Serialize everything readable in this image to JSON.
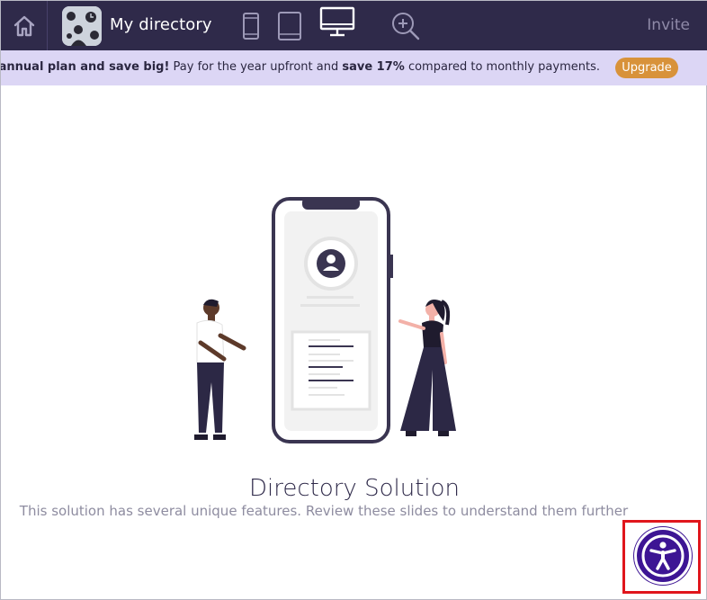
{
  "header": {
    "app_title": "My directory",
    "invite_label": "Invite",
    "icons": {
      "home": "home-icon",
      "mobile": "mobile-device-icon",
      "tablet": "tablet-device-icon",
      "desktop": "desktop-device-icon",
      "zoom": "zoom-in-icon"
    }
  },
  "banner": {
    "bold_lead": "Upgrade to an annual plan and save big!",
    "text_mid": " Pay for the year upfront and ",
    "bold_save": "save 17%",
    "text_end": " compared to monthly payments.",
    "upgrade_label": "Upgrade"
  },
  "main": {
    "heading": "Directory Solution",
    "subheading": "This solution has several unique features. Review these slides to understand them further"
  },
  "accessibility": {
    "icon": "accessibility-icon"
  },
  "colors": {
    "topbar": "#2f2a4a",
    "banner": "#dcd6f5",
    "upgrade": "#d8923a",
    "accessibility": "#3d1594",
    "highlight": "#e0161c"
  }
}
